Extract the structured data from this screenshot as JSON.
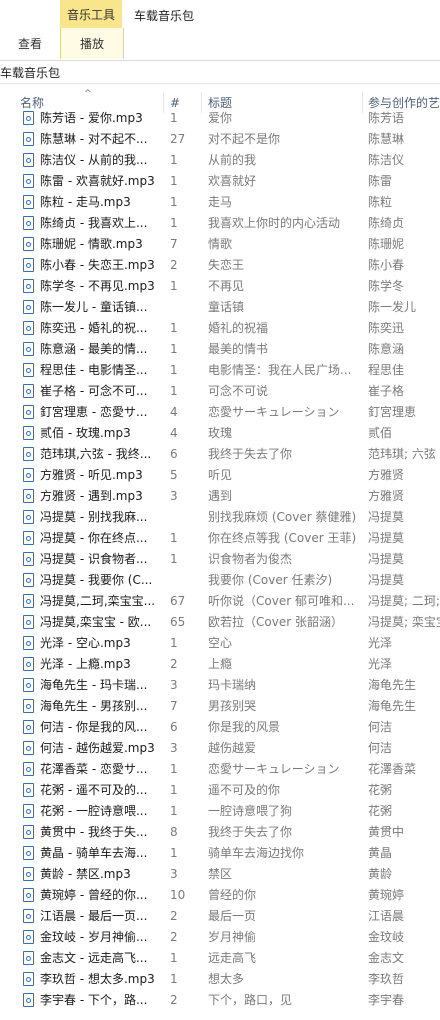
{
  "ribbon": {
    "context_tab": "音乐工具",
    "window_title": "车载音乐包",
    "tabs": [
      "查看",
      "播放"
    ]
  },
  "address": {
    "path": "车载音乐包"
  },
  "columns": {
    "name": "名称",
    "num": "#",
    "title": "标题",
    "artist": "参与创作的艺"
  },
  "rows": [
    {
      "name": "陈芳语 - 爱你.mp3",
      "num": "1",
      "title": "爱你",
      "artist": "陈芳语"
    },
    {
      "name": "陈慧琳 - 对不起不...",
      "num": "27",
      "title": "对不起不是你",
      "artist": "陈慧琳"
    },
    {
      "name": "陈洁仪 - 从前的我...",
      "num": "1",
      "title": "从前的我",
      "artist": "陈洁仪"
    },
    {
      "name": "陈雷 - 欢喜就好.mp3",
      "num": "1",
      "title": "欢喜就好",
      "artist": "陈雷"
    },
    {
      "name": "陈粒 - 走马.mp3",
      "num": "1",
      "title": "走马",
      "artist": "陈粒"
    },
    {
      "name": "陈绮贞 - 我喜欢上...",
      "num": "1",
      "title": "我喜欢上你时的内心活动",
      "artist": "陈绮贞"
    },
    {
      "name": "陈珊妮 - 情歌.mp3",
      "num": "7",
      "title": "情歌",
      "artist": "陈珊妮"
    },
    {
      "name": "陈小春 - 失恋王.mp3",
      "num": "2",
      "title": "失恋王",
      "artist": "陈小春"
    },
    {
      "name": "陈学冬 - 不再见.mp3",
      "num": "1",
      "title": "不再见",
      "artist": "陈学冬"
    },
    {
      "name": "陈一发儿 - 童话镇...",
      "num": "",
      "title": "童话镇",
      "artist": "陈一发儿"
    },
    {
      "name": "陈奕迅 - 婚礼的祝...",
      "num": "1",
      "title": "婚礼的祝福",
      "artist": "陈奕迅"
    },
    {
      "name": "陈意涵 - 最美的情...",
      "num": "1",
      "title": "最美的情书",
      "artist": "陈意涵"
    },
    {
      "name": "程思佳 - 电影情圣...",
      "num": "1",
      "title": "电影情圣：我在人民广场...",
      "artist": "程思佳"
    },
    {
      "name": "崔子格 - 可念不可...",
      "num": "1",
      "title": "可念不可说",
      "artist": "崔子格"
    },
    {
      "name": "釘宮理恵 - 恋愛サ...",
      "num": "4",
      "title": "恋愛サーキュレーション",
      "artist": "釘宮理恵"
    },
    {
      "name": "贰佰 - 玫瑰.mp3",
      "num": "4",
      "title": "玫瑰",
      "artist": "贰佰"
    },
    {
      "name": "范玮琪,六弦 - 我终...",
      "num": "6",
      "title": "我终于失去了你",
      "artist": "范玮琪; 六弦"
    },
    {
      "name": "方雅贤 - 听见.mp3",
      "num": "5",
      "title": "听见",
      "artist": "方雅贤"
    },
    {
      "name": "方雅贤 - 遇到.mp3",
      "num": "3",
      "title": "遇到",
      "artist": "方雅贤"
    },
    {
      "name": "冯提莫 - 别找我麻...",
      "num": "",
      "title": "别找我麻烦 (Cover 蔡健雅)",
      "artist": "冯提莫"
    },
    {
      "name": "冯提莫 - 你在终点...",
      "num": "1",
      "title": "你在终点等我 (Cover 王菲)",
      "artist": "冯提莫"
    },
    {
      "name": "冯提莫 - 识食物者...",
      "num": "1",
      "title": "识食物者为俊杰",
      "artist": "冯提莫"
    },
    {
      "name": "冯提莫 - 我要你 (C...",
      "num": "",
      "title": "我要你 (Cover 任素汐)",
      "artist": "冯提莫"
    },
    {
      "name": "冯提莫,二珂,栾宝宝...",
      "num": "67",
      "title": "听你说（Cover 郁可唯和...",
      "artist": "冯提莫; 二珂; 栾"
    },
    {
      "name": "冯提莫,栾宝宝 - 欧...",
      "num": "65",
      "title": "欧若拉（Cover 张韶涵）",
      "artist": "冯提莫; 栾宝宝"
    },
    {
      "name": "光泽 - 空心.mp3",
      "num": "1",
      "title": "空心",
      "artist": "光泽"
    },
    {
      "name": "光泽 - 上瘾.mp3",
      "num": "2",
      "title": "上瘾",
      "artist": "光泽"
    },
    {
      "name": "海龟先生 - 玛卡瑞...",
      "num": "3",
      "title": "玛卡瑞纳",
      "artist": "海龟先生"
    },
    {
      "name": "海龟先生 - 男孩别...",
      "num": "7",
      "title": "男孩别哭",
      "artist": "海龟先生"
    },
    {
      "name": "何洁 - 你是我的风...",
      "num": "6",
      "title": "你是我的风景",
      "artist": "何洁"
    },
    {
      "name": "何洁 - 越伤越爱.mp3",
      "num": "3",
      "title": "越伤越爱",
      "artist": "何洁"
    },
    {
      "name": "花澤香菜 - 恋愛サ...",
      "num": "1",
      "title": "恋愛サーキュレーション",
      "artist": "花澤香菜"
    },
    {
      "name": "花粥 - 遥不可及的...",
      "num": "1",
      "title": "遥不可及的你",
      "artist": "花粥"
    },
    {
      "name": "花粥 - 一腔诗意喂...",
      "num": "1",
      "title": "一腔诗意喂了狗",
      "artist": "花粥"
    },
    {
      "name": "黄贯中 - 我终于失...",
      "num": "8",
      "title": "我终于失去了你",
      "artist": "黄贯中"
    },
    {
      "name": "黄晶 - 骑单车去海...",
      "num": "1",
      "title": "骑单车去海边找你",
      "artist": "黄晶"
    },
    {
      "name": "黄龄 - 禁区.mp3",
      "num": "3",
      "title": "禁区",
      "artist": "黄龄"
    },
    {
      "name": "黄琬婷 - 曾经的你...",
      "num": "10",
      "title": "曾经的你",
      "artist": "黄琬婷"
    },
    {
      "name": "江语晨 - 最后一页...",
      "num": "2",
      "title": "最后一页",
      "artist": "江语晨"
    },
    {
      "name": "金玟岐 - 岁月神偷...",
      "num": "2",
      "title": "岁月神偷",
      "artist": "金玟岐"
    },
    {
      "name": "金志文 - 远走高飞...",
      "num": "1",
      "title": "远走高飞",
      "artist": "金志文"
    },
    {
      "name": "李玖哲 - 想太多.mp3",
      "num": "1",
      "title": "想太多",
      "artist": "李玖哲"
    },
    {
      "name": "李宇春 - 下个，路...",
      "num": "2",
      "title": "下个，路口，见",
      "artist": "李宇春"
    }
  ]
}
